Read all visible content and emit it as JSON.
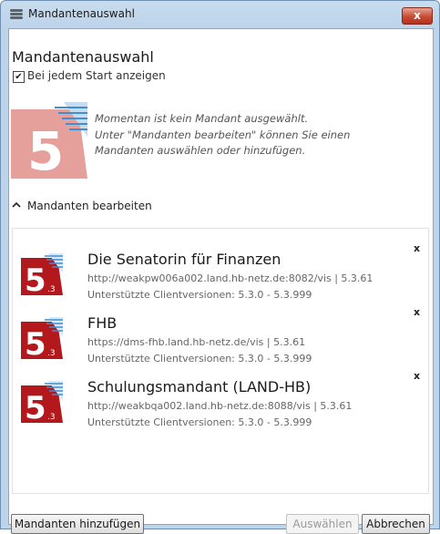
{
  "window": {
    "title": "Mandantenauswahl",
    "close_label": "x"
  },
  "heading": "Mandantenauswahl",
  "show_on_start": {
    "label": "Bei jedem Start anzeigen",
    "checked": true
  },
  "info": {
    "logo_digit": "5",
    "lines": [
      "Momentan ist kein Mandant ausgewählt.",
      "Unter \"Mandanten bearbeiten\" können Sie einen",
      "Mandanten auswählen oder hinzufügen."
    ]
  },
  "expander": {
    "label": "Mandanten bearbeiten",
    "expanded": true
  },
  "mandanten": [
    {
      "name": "Die Senatorin für Finanzen",
      "url": "http://weakpw006a002.land.hb-netz.de:8082/vis | 5.3.61",
      "versions": "Unterstützte Clientversionen: 5.3.0 - 5.3.999",
      "logo_digit": "5",
      "logo_sub": ".3",
      "remove": "x"
    },
    {
      "name": "FHB",
      "url": "https://dms-fhb.land.hb-netz.de/vis | 5.3.61",
      "versions": "Unterstützte Clientversionen: 5.3.0 - 5.3.999",
      "logo_digit": "5",
      "logo_sub": ".3",
      "remove": "x"
    },
    {
      "name": "Schulungsmandant (LAND-HB)",
      "url": "http://weakbqa002.land.hb-netz.de:8088/vis | 5.3.61",
      "versions": "Unterstützte Clientversionen: 5.3.0 - 5.3.999",
      "logo_digit": "5",
      "logo_sub": ".3",
      "remove": "x"
    }
  ],
  "buttons": {
    "add": "Mandanten hinzufügen",
    "select": "Auswählen",
    "cancel": "Abbrechen",
    "select_enabled": false
  },
  "colors": {
    "logo_red": "#b3181d",
    "logo_pale": "#e6a09c",
    "accent_blue": "#3f8fd2"
  }
}
